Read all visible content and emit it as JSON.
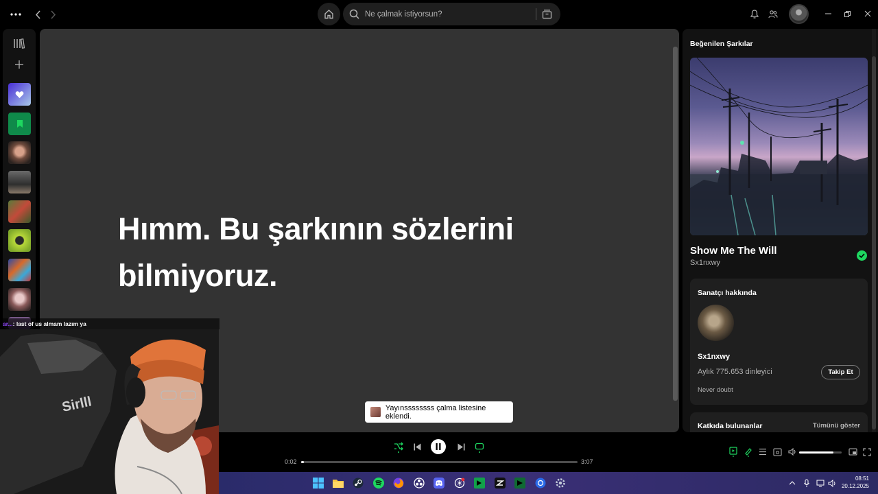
{
  "topbar": {
    "search_placeholder": "Ne çalmak istiyorsun?",
    "icons": [
      "more-icon",
      "back-icon",
      "forward-icon",
      "home-icon",
      "search-icon",
      "browse-icon",
      "bell-icon",
      "friends-icon",
      "avatar",
      "minimize-icon",
      "maximize-icon",
      "close-icon"
    ]
  },
  "lyrics": {
    "message": "Hımm. Bu şarkının sözlerini bilmiyoruz."
  },
  "now_playing_panel": {
    "title": "Beğenilen Şarkılar",
    "song_title": "Show Me The Will",
    "song_artist": "Sx1nxwy",
    "artist_card": {
      "heading": "Sanatçı hakkında",
      "artist_name": "Sx1nxwy",
      "monthly_listeners": "Aylık 775.653 dinleyici",
      "follow_label": "Takip Et",
      "bio": "Never doubt"
    },
    "credits_card": {
      "heading": "Katkıda bulunanlar",
      "show_all": "Tümünü göster"
    }
  },
  "toast": {
    "text": "Yayınssssssss çalma listesine eklendi."
  },
  "player": {
    "time_current": "0:02",
    "time_total": "3:07",
    "progress_fraction": 0.011,
    "volume_fraction": 0.8,
    "shuffle_active": true,
    "repeat_active": true,
    "is_playing": true
  },
  "chat": {
    "user": "ar...",
    "message": ": last of us almam lazım ya"
  },
  "taskbar": {
    "time": "08:51",
    "date": "20.12.2025"
  },
  "colors": {
    "accent": "#1ed760",
    "panel_bg": "#121212",
    "lyrics_bg": "#333333",
    "chat_user": "#9147ff"
  }
}
